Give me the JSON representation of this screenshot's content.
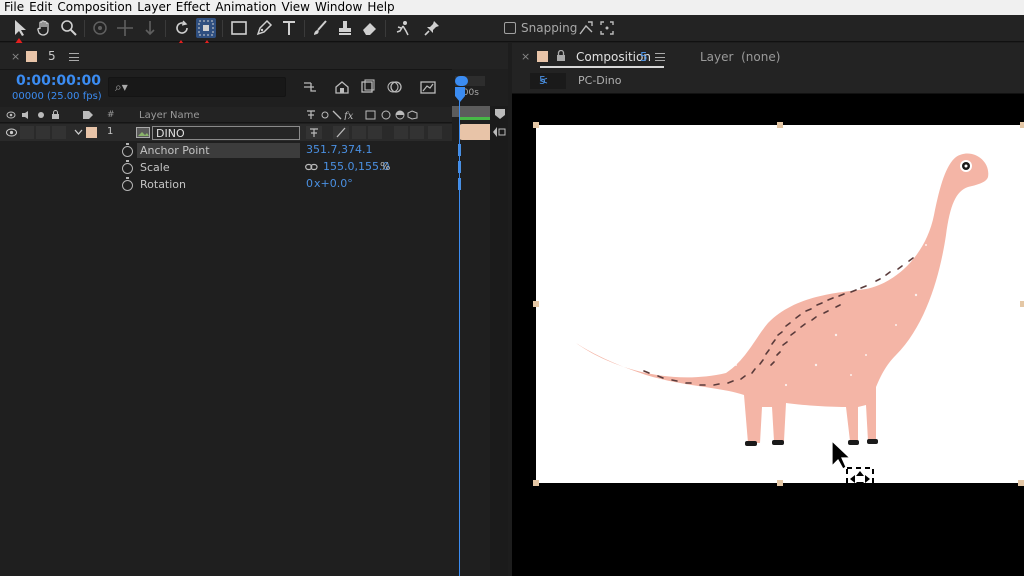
{
  "menu": [
    "File",
    "Edit",
    "Composition",
    "Layer",
    "Effect",
    "Animation",
    "View",
    "Window",
    "Help"
  ],
  "toolbar": {
    "tools": [
      "selection-icon",
      "hand-icon",
      "zoom-icon",
      "orbit-icon",
      "pan-icon",
      "dolly-icon",
      "rotation-icon",
      "pan-behind-icon",
      "rectangle-icon",
      "pen-icon",
      "type-icon",
      "brush-icon",
      "clone-stamp-icon",
      "eraser-icon",
      "roto-brush-icon",
      "puppet-pin-icon"
    ],
    "snapping_label": "Snapping"
  },
  "timeline": {
    "tab_label": "5",
    "timecode": "0:00:00:00",
    "fps": "00000 (25.00 fps)",
    "column_hash": "#",
    "column_layer_name": "Layer Name",
    "ruler_label": "1:00s",
    "layer": {
      "index": "1",
      "name": "DINO",
      "swatch": "#e8c4a8"
    },
    "properties": [
      {
        "name": "Anchor Point",
        "value": "351.7,374.1"
      },
      {
        "name": "Scale",
        "value": "155.0,155.0",
        "unit": "%"
      },
      {
        "name": "Rotation",
        "value": "0",
        "suffix": "x+0.0°"
      }
    ]
  },
  "composition": {
    "tab_label": "Composition",
    "tab_number": "5",
    "layer_tab": "Layer  (none)",
    "breadcrumb_num": "5",
    "breadcrumb_name": "PC-Dino"
  },
  "colors": {
    "accent": "#3b8cf2",
    "arrow": "#e41f1f",
    "dino": "#f4b5a6",
    "label": "#e8c4a8"
  }
}
